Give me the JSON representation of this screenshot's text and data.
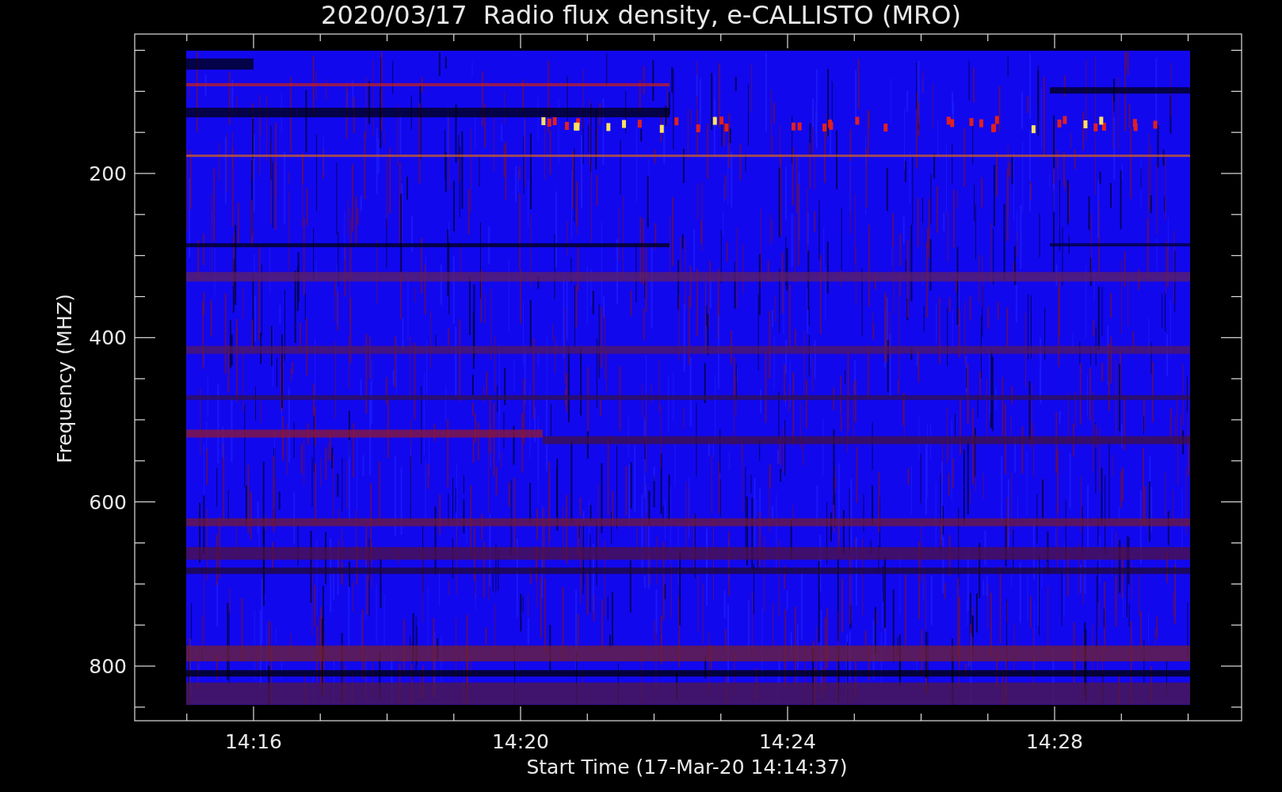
{
  "title": "2020/03/17  Radio flux density, e-CALLISTO (MRO)",
  "y_axis": {
    "label": "Frequency (MHZ)",
    "ticks": [
      "200",
      "400",
      "600",
      "800"
    ]
  },
  "x_axis": {
    "label": "Start Time (17-Mar-20 14:14:37)",
    "ticks": [
      "14:16",
      "14:20",
      "14:24",
      "14:28"
    ]
  }
}
